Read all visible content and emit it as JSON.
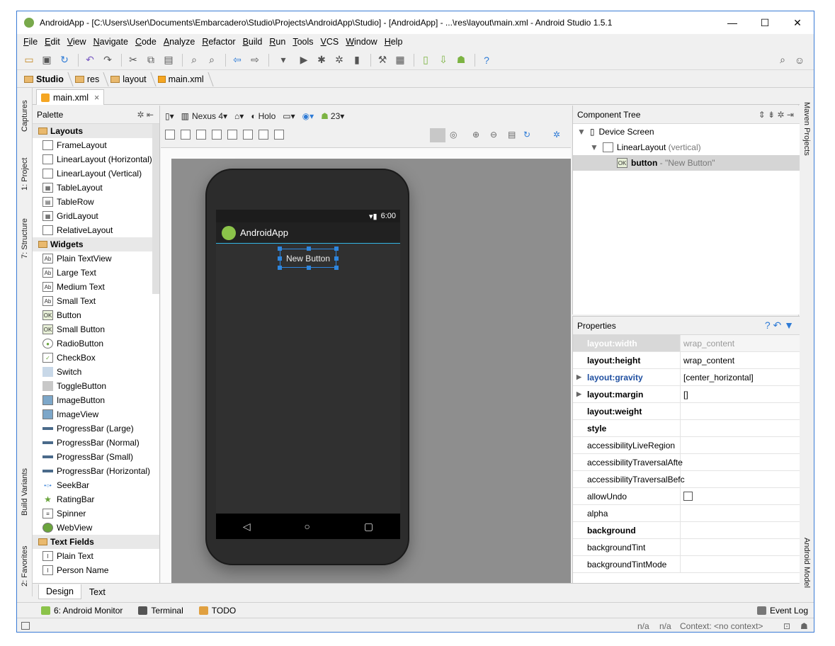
{
  "window": {
    "title": "AndroidApp - [C:\\Users\\User\\Documents\\Embarcadero\\Studio\\Projects\\AndroidApp\\Studio] - [AndroidApp] - ...\\res\\layout\\main.xml - Android Studio 1.5.1",
    "controls": {
      "minimize": "—",
      "maximize": "☐",
      "close": "✕"
    }
  },
  "menu": [
    "File",
    "Edit",
    "View",
    "Navigate",
    "Code",
    "Analyze",
    "Refactor",
    "Build",
    "Run",
    "Tools",
    "VCS",
    "Window",
    "Help"
  ],
  "breadcrumb": [
    "Studio",
    "res",
    "layout",
    "main.xml"
  ],
  "editor_tab": {
    "label": "main.xml",
    "close": "×"
  },
  "left_strip": {
    "captures": "Captures",
    "project": "1: Project",
    "structure": "7: Structure",
    "build_variants": "Build Variants",
    "favorites": "2: Favorites"
  },
  "right_strip": {
    "maven": "Maven Projects",
    "android_model": "Android Model"
  },
  "palette": {
    "title": "Palette",
    "groups": [
      {
        "label": "Layouts",
        "items": [
          "FrameLayout",
          "LinearLayout (Horizontal)",
          "LinearLayout (Vertical)",
          "TableLayout",
          "TableRow",
          "GridLayout",
          "RelativeLayout"
        ]
      },
      {
        "label": "Widgets",
        "items": [
          "Plain TextView",
          "Large Text",
          "Medium Text",
          "Small Text",
          "Button",
          "Small Button",
          "RadioButton",
          "CheckBox",
          "Switch",
          "ToggleButton",
          "ImageButton",
          "ImageView",
          "ProgressBar (Large)",
          "ProgressBar (Normal)",
          "ProgressBar (Small)",
          "ProgressBar (Horizontal)",
          "SeekBar",
          "RatingBar",
          "Spinner",
          "WebView"
        ]
      },
      {
        "label": "Text Fields",
        "items": [
          "Plain Text",
          "Person Name"
        ]
      }
    ]
  },
  "design_toolbar": {
    "device": "Nexus 4",
    "theme": "Holo",
    "api": "23"
  },
  "preview": {
    "status_time": "6:00",
    "app_name": "AndroidApp",
    "button_text": "New Button"
  },
  "component_tree": {
    "title": "Component Tree",
    "root": "Device Screen",
    "layout": "LinearLayout",
    "layout_hint": "(vertical)",
    "button": "button",
    "button_hint": "- \"New Button\""
  },
  "properties": {
    "title": "Properties",
    "rows": [
      {
        "name": "layout:width",
        "value": "wrap_content"
      },
      {
        "name": "layout:height",
        "value": "wrap_content"
      },
      {
        "name": "layout:gravity",
        "value": "[center_horizontal]"
      },
      {
        "name": "layout:margin",
        "value": "[]"
      },
      {
        "name": "layout:weight",
        "value": ""
      },
      {
        "name": "style",
        "value": ""
      },
      {
        "name": "accessibilityLiveRegion",
        "value": ""
      },
      {
        "name": "accessibilityTraversalAfte",
        "value": ""
      },
      {
        "name": "accessibilityTraversalBefc",
        "value": ""
      },
      {
        "name": "allowUndo",
        "value": ""
      },
      {
        "name": "alpha",
        "value": ""
      },
      {
        "name": "background",
        "value": ""
      },
      {
        "name": "backgroundTint",
        "value": ""
      },
      {
        "name": "backgroundTintMode",
        "value": ""
      }
    ]
  },
  "bottom_tabs": [
    "Design",
    "Text"
  ],
  "tool_windows": {
    "monitor": "6: Android Monitor",
    "terminal": "Terminal",
    "todo": "TODO",
    "event_log": "Event Log"
  },
  "status": {
    "na1": "n/a",
    "na2": "n/a",
    "context": "Context: <no context>"
  }
}
